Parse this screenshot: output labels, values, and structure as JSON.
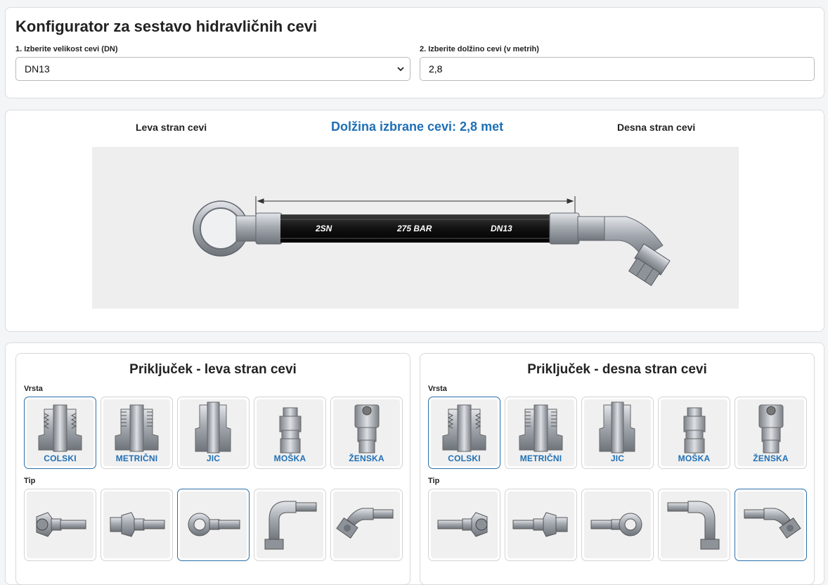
{
  "header": {
    "title": "Konfigurator za sestavo hidravličnih cevi",
    "size_label": "1. Izberite velikost cevi (DN)",
    "size_value": "DN13",
    "length_label": "2. Izberite dolžino cevi (v metrih)",
    "length_value": "2,8"
  },
  "preview": {
    "left_label": "Leva stran cevi",
    "length_caption": "Dolžina izbrane cevi: 2,8 met",
    "right_label": "Desna stran cevi",
    "hose_print": [
      "2SN",
      "275 BAR",
      "DN13"
    ]
  },
  "left_panel": {
    "title": "Priključek - leva stran cevi",
    "type_label": "Vrsta",
    "types": [
      {
        "label": "COLSKI",
        "icon": "colski-fitting-icon",
        "selected": true
      },
      {
        "label": "METRIČNI",
        "icon": "metric-fitting-icon",
        "selected": false
      },
      {
        "label": "JIC",
        "icon": "jic-fitting-icon",
        "selected": false
      },
      {
        "label": "MOŠKA",
        "icon": "male-coupling-icon",
        "selected": false
      },
      {
        "label": "ŽENSKA",
        "icon": "female-coupling-icon",
        "selected": false
      }
    ],
    "tip_label": "Tip",
    "tips": [
      {
        "icon": "female-swivel-straight-icon",
        "selected": false
      },
      {
        "icon": "male-straight-icon",
        "selected": false
      },
      {
        "icon": "banjo-icon",
        "selected": true
      },
      {
        "icon": "elbow-90-icon",
        "selected": false
      },
      {
        "icon": "elbow-45-icon",
        "selected": false
      }
    ]
  },
  "right_panel": {
    "title": "Priključek - desna stran cevi",
    "type_label": "Vrsta",
    "types": [
      {
        "label": "COLSKI",
        "icon": "colski-fitting-icon",
        "selected": true
      },
      {
        "label": "METRIČNI",
        "icon": "metric-fitting-icon",
        "selected": false
      },
      {
        "label": "JIC",
        "icon": "jic-fitting-icon",
        "selected": false
      },
      {
        "label": "MOŠKA",
        "icon": "male-coupling-icon",
        "selected": false
      },
      {
        "label": "ŽENSKA",
        "icon": "female-coupling-icon",
        "selected": false
      }
    ],
    "tip_label": "Tip",
    "tips": [
      {
        "icon": "female-swivel-straight-icon",
        "selected": false
      },
      {
        "icon": "male-straight-icon",
        "selected": false
      },
      {
        "icon": "banjo-icon",
        "selected": false
      },
      {
        "icon": "elbow-90-icon",
        "selected": false
      },
      {
        "icon": "elbow-45-icon",
        "selected": true
      }
    ]
  },
  "colors": {
    "accent": "#1f6fb5",
    "selected_border": "#2a6fa8",
    "hose": "#111111",
    "metal": "#a9adb3"
  }
}
